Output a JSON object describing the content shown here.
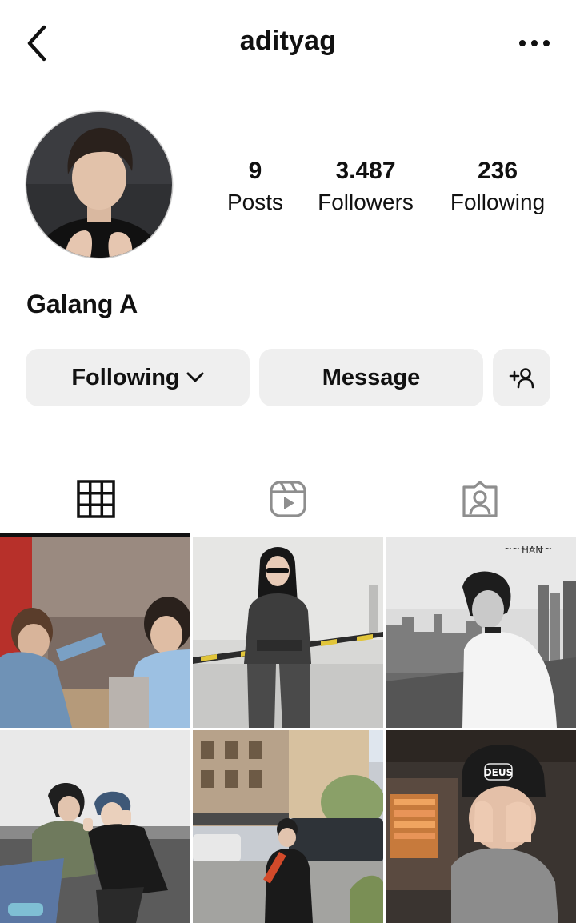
{
  "header": {
    "username": "adityag",
    "back_icon": "chevron-left-icon",
    "more_icon": "more-horizontal-icon"
  },
  "profile": {
    "display_name": "Galang A",
    "stats": [
      {
        "value": "9",
        "label": "Posts"
      },
      {
        "value": "3.487",
        "label": "Followers"
      },
      {
        "value": "236",
        "label": "Following"
      }
    ]
  },
  "actions": {
    "following_label": "Following",
    "message_label": "Message",
    "add_user_icon": "add-user-icon"
  },
  "tabs": [
    {
      "name": "grid",
      "icon": "grid-icon",
      "selected": true
    },
    {
      "name": "reels",
      "icon": "reels-icon",
      "selected": false
    },
    {
      "name": "tagged",
      "icon": "tagged-icon",
      "selected": false
    }
  ],
  "posts": {
    "count": 6,
    "overlay_texts": [
      "HAN",
      "DEUS"
    ]
  },
  "colors": {
    "button_bg": "#efefef",
    "text": "#111111",
    "icon_gray": "#8e8e8e"
  }
}
